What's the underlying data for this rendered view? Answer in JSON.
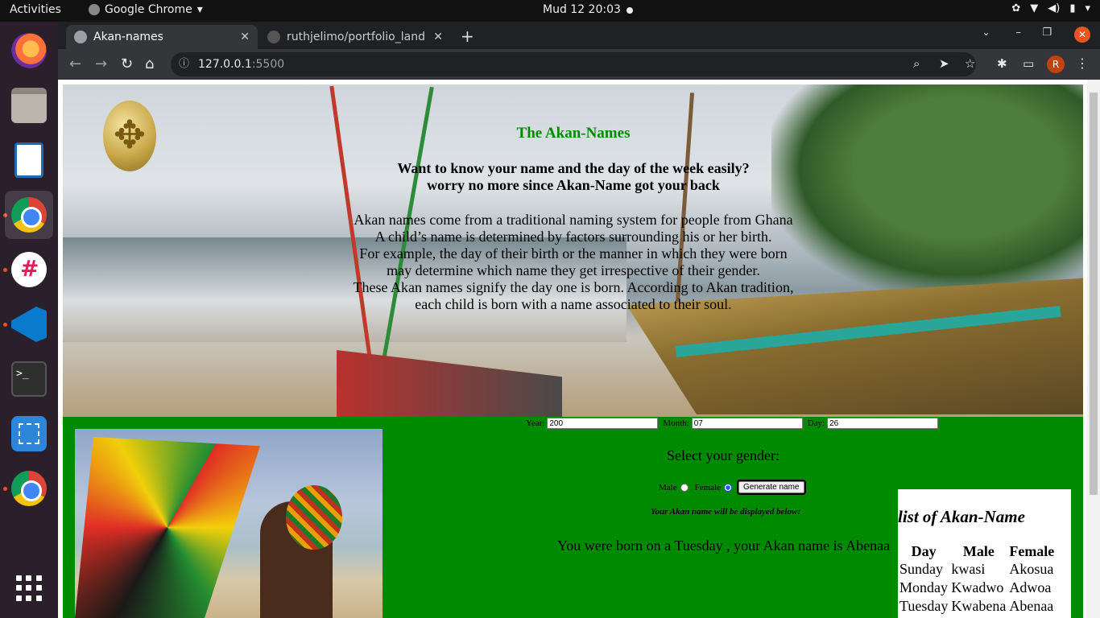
{
  "topbar": {
    "activities": "Activities",
    "app_name": "Google Chrome",
    "clock": "Mud 12  20:03"
  },
  "dock": {
    "items": [
      "firefox-icon",
      "files-icon",
      "writer-icon",
      "chrome-icon",
      "slack-icon",
      "vscode-icon",
      "terminal-icon",
      "screenshot-icon",
      "chrome-icon",
      "show-apps-icon"
    ]
  },
  "browser": {
    "tabs": [
      {
        "title": "Akan-names",
        "active": true
      },
      {
        "title": "ruthjelimo/portfolio_land",
        "active": false
      }
    ],
    "url_host": "127.0.0.1",
    "url_port": ":5500",
    "profile_initial": "R"
  },
  "page": {
    "heading": "The Akan-Names",
    "tagline_1": "Want to know your name and the day of the week easily?",
    "tagline_2": "worry no more since Akan-Name got your back",
    "intro_lines": [
      "Akan names come from a traditional naming system for people from Ghana",
      "A child’s name is determined by factors surrounding his or her birth.",
      "For example, the day of their birth or the manner in which they were born",
      "may determine which name they get irrespective of their gender.",
      "These Akan names signify the day one is born. According to Akan tradition,",
      "each child is born with a name associated to their soul."
    ],
    "form": {
      "year_label": "Year:",
      "year_value": "200",
      "month_label": "Month:",
      "month_value": "07",
      "day_label": "Day:",
      "day_value": "26",
      "gender_prompt": "Select your gender:",
      "male_label": "Male",
      "female_label": "Female",
      "selected_gender": "Female",
      "generate_label": "Generate name"
    },
    "display_note": "Your Akan name will be displayed below:",
    "result": "You were born on a Tuesday , your Akan name is Abenaa",
    "table": {
      "title": "list of Akan-Name",
      "headers": [
        "Day",
        "Male",
        "Female"
      ],
      "rows": [
        [
          "Sunday",
          "kwasi",
          "Akosua"
        ],
        [
          "Monday",
          "Kwadwo",
          "Adwoa"
        ],
        [
          "Tuesday",
          "Kwabena",
          "Abenaa"
        ]
      ]
    }
  }
}
